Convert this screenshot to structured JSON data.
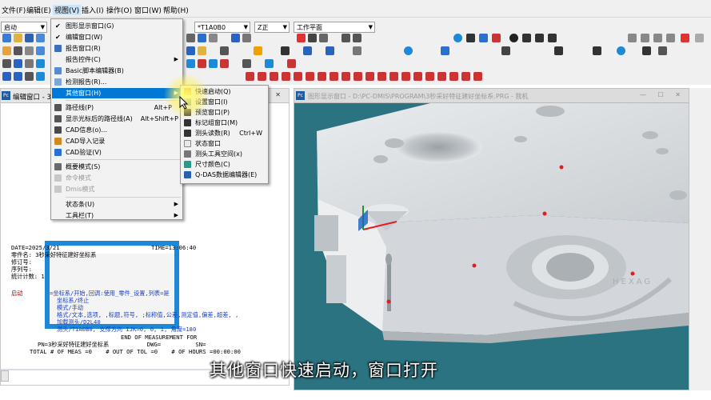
{
  "menubar": {
    "items": [
      "文件(F)",
      "编辑(E)",
      "视图(V)",
      "插入(I)",
      "操作(O)",
      "窗口(W)",
      "帮助(H)"
    ]
  },
  "toolbar": {
    "mode_combo": "启动",
    "probe_combo": "*T1A0B0",
    "view_combo": "Z正",
    "workplane_combo": "工作平面"
  },
  "view_menu": {
    "items": [
      {
        "label": "图形显示窗口(G)",
        "check": true
      },
      {
        "label": "编辑窗口(W)",
        "check": true
      },
      {
        "label": "报告窗口(R)",
        "icon": true
      },
      {
        "label": "报告控件(C)",
        "sub": true
      },
      {
        "label": "Basic脚本编辑器(B)",
        "icon": true
      },
      {
        "label": "检测报告(R)...",
        "icon": true
      },
      {
        "label": "其他窗口(H)",
        "sub": true,
        "highlight": true
      },
      {
        "label": "路径线(P)",
        "shortcut": "Alt+P",
        "icon": true
      },
      {
        "label": "显示光标后的路径线(A)",
        "shortcut": "Alt+Shift+P",
        "icon": true
      },
      {
        "label": "CAD信息(o)...",
        "icon": true
      },
      {
        "label": "CAD导入记录",
        "icon": true
      },
      {
        "label": "CAD验证(V)",
        "icon": true
      },
      {
        "label": "概要模式(S)",
        "icon": true
      },
      {
        "label": "命令模式",
        "disabled": true
      },
      {
        "label": "Dmis模式",
        "disabled": true
      },
      {
        "label": "状态条(U)",
        "sub": true
      },
      {
        "label": "工具栏(T)",
        "sub": true
      }
    ]
  },
  "other_windows_menu": {
    "items": [
      {
        "label": "快速启动(Q)"
      },
      {
        "label": "设置窗口(I)"
      },
      {
        "label": "预览窗口(P)"
      },
      {
        "label": "标记组窗口(M)"
      },
      {
        "label": "测头读数(R)",
        "shortcut": "Ctrl+W"
      },
      {
        "label": "状态窗口"
      },
      {
        "label": "测头工具空间(x)"
      },
      {
        "label": "尺寸颜色(C)"
      },
      {
        "label": "Q-DAS数据编辑器(E)"
      }
    ]
  },
  "edit_window": {
    "title": "编辑窗口 - 3秒",
    "report": {
      "date": "DATE=2025/3/21",
      "time": "TIME=13:06:40",
      "part_name": "零件名: 3秒采好特征建好坐标系",
      "rev": "修订号:",
      "serial": "序列号:",
      "stat_count": "统计计数: 1"
    },
    "code_lines": [
      {
        "kw": "启动",
        "text": "=坐标系/开始,回调:使用_零件_设置,列表=是"
      },
      {
        "kw": "",
        "text": "坐标系/终止"
      },
      {
        "kw": "",
        "text": "模式/手动"
      },
      {
        "kw": "",
        "text": "格式/文本,选项, ,标题,符号, ;标称值,公差,测定值,偏差,超差, ,"
      },
      {
        "kw": "",
        "text": "加载测头/D2L40"
      },
      {
        "kw": "",
        "text": "测头/T1A0B0, 支撑方向 IJK=0, 0, 1, 角度=180"
      }
    ],
    "end_lines": [
      "END OF MEASUREMENT FOR",
      "PN=3秒采好特征建好坐标系           DWG=          SN=",
      "TOTAL # OF MEAS =0    # OUT OF TOL =0    # OF HOURS =00:00:00"
    ]
  },
  "graphics_window": {
    "title": "图形显示窗口 - D:\\PC-DMIS\\PROGRAM\\3秒采好特征建好坐标系.PRG - 我机",
    "watermark": "HEXAG"
  },
  "subtitle": "其他窗口快速启动，窗口打开",
  "colors": {
    "highlight": "#0078d7",
    "viewport_bg": "#2b7381",
    "part": "#d7dbde",
    "point": "#e11d1d",
    "blue_panel": "#1d87d8"
  }
}
